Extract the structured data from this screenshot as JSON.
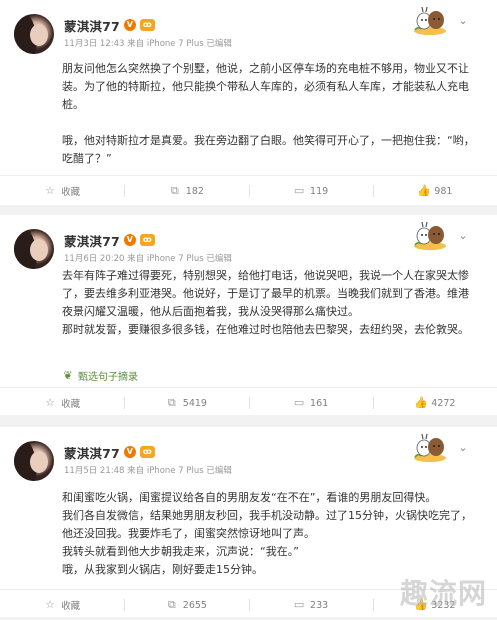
{
  "posts": [
    {
      "user": "蒙淇淇77",
      "time": "11月3日 12:43",
      "source": "来自 iPhone 7 Plus",
      "edited": "已编辑",
      "paragraphs": [
        "朋友问他怎么突然换了个别墅，他说，之前小区停车场的充电桩不够用，物业又不让装。为了他的特斯拉，他只能换个带私人车库的，必须有私人车库，才能装私人充电桩。",
        "",
        "哦，他对特斯拉才是真爱。我在旁边翻了白眼。他笑得可开心了，一把抱住我：“哟，吃醋了？”"
      ],
      "actions": {
        "favorite": "收藏",
        "repost": "182",
        "comment": "119",
        "like": "981"
      }
    },
    {
      "user": "蒙淇淇77",
      "time": "11月6日 20:20",
      "source": "来自 iPhone 7 Plus",
      "edited": "已编辑",
      "paragraphs": [
        "去年有阵子难过得要死，特别想哭，给他打电话，他说哭吧，我说一个人在家哭太惨了，要去维多利亚港哭。他说好，于是订了最早的机票。当晚我们就到了香港。维港夜景闪耀又温暖，他从后面抱着我，我从没哭得那么痛快过。",
        "那时就发誓，要赚很多很多钱，在他难过时也陪他去巴黎哭，去纽约哭，去伦敦哭。"
      ],
      "excerpt": "甄选句子摘录",
      "actions": {
        "favorite": "收藏",
        "repost": "5419",
        "comment": "161",
        "like": "4272"
      }
    },
    {
      "user": "蒙淇淇77",
      "time": "11月5日 21:48",
      "source": "来自 iPhone 7 Plus",
      "edited": "已编辑",
      "paragraphs": [
        "和闺蜜吃火锅，闺蜜提议给各自的男朋友发“在不在”，看谁的男朋友回得快。",
        "我们各自发微信，结果她男朋友秒回，我手机没动静。过了15分钟，火锅快吃完了，他还没回我。我要炸毛了，闺蜜突然惊讶地叫了声。",
        "我转头就看到他大步朝我走来，沉声说：“我在。”",
        "哦，从我家到火锅店，刚好要走15分钟。"
      ],
      "actions": {
        "favorite": "收藏",
        "repost": "2655",
        "comment": "233",
        "like": "3232"
      }
    }
  ],
  "watermark": "趣流网",
  "icons": {
    "favorite": "star-icon",
    "repost": "repost-icon",
    "comment": "comment-icon",
    "like": "thumbs-up-icon",
    "more": "chevron-down-icon",
    "excerpt": "leaf-icon"
  },
  "colors": {
    "accent": "#f07a00",
    "excerpt": "#5a8e3c",
    "meta": "#999999"
  }
}
